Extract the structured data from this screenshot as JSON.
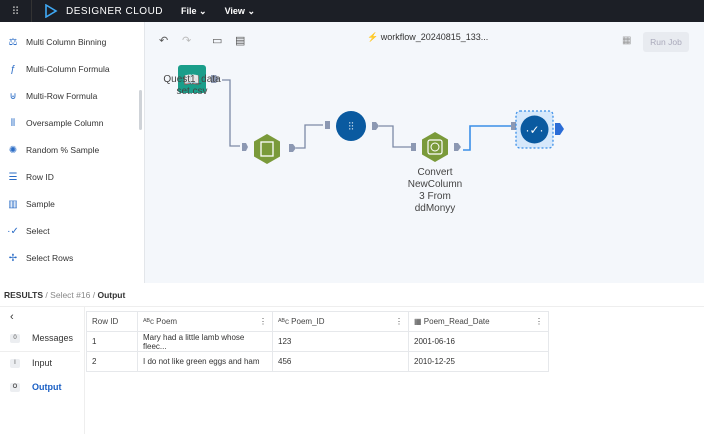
{
  "topbar": {
    "brand": "DESIGNER CLOUD",
    "menus": [
      "File",
      "View"
    ]
  },
  "sidebar": {
    "items": [
      {
        "label": "Multi Column Binning",
        "icon": "binning-icon"
      },
      {
        "label": "Multi-Column Formula",
        "icon": "formula-icon"
      },
      {
        "label": "Multi-Row Formula",
        "icon": "multirow-icon"
      },
      {
        "label": "Oversample Column",
        "icon": "oversample-icon"
      },
      {
        "label": "Random % Sample",
        "icon": "random-icon"
      },
      {
        "label": "Row ID",
        "icon": "rowid-icon"
      },
      {
        "label": "Sample",
        "icon": "sample-icon"
      },
      {
        "label": "Select",
        "icon": "select-icon"
      },
      {
        "label": "Select Rows",
        "icon": "select-rows-icon"
      }
    ]
  },
  "canvas": {
    "workflow_name": "workflow_20240815_133...",
    "run_job": "Run Job",
    "nodes": {
      "input": "Quest1_data set.csv",
      "formula_l1": "Convert",
      "formula_l2": "NewColumn",
      "formula_l3": "3 From",
      "formula_l4": "ddMonyy"
    },
    "colors": {
      "teal": "#1a9e8a",
      "green": "#7a9a3a",
      "blue": "#0a5aa0"
    }
  },
  "results": {
    "root": "RESULTS",
    "tool": "Select #16",
    "view": "Output"
  },
  "panel": {
    "tabs": [
      {
        "count": "0",
        "label": "Messages"
      },
      {
        "count": "I",
        "label": "Input"
      },
      {
        "count": "O",
        "label": "Output"
      }
    ],
    "columns": [
      "Row ID",
      "Poem",
      "Poem_ID",
      "Poem_Read_Date"
    ],
    "rows": [
      [
        "1",
        "Mary had a little lamb whose fleec...",
        "123",
        "2001-06-16"
      ],
      [
        "2",
        "I do not like green eggs and ham",
        "456",
        "2010-12-25"
      ]
    ]
  }
}
